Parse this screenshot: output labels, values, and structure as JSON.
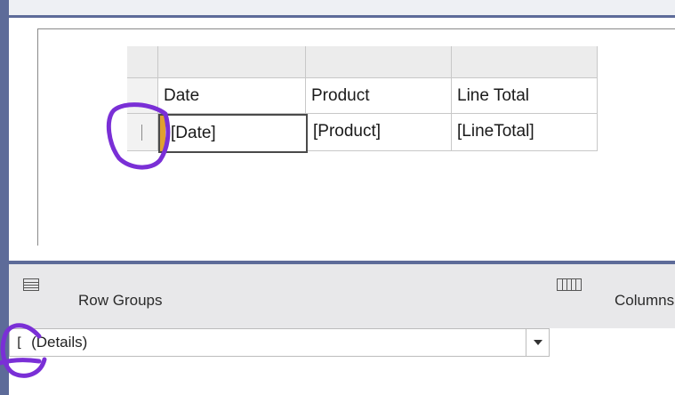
{
  "tablix": {
    "header_row": [
      "Date",
      "Product",
      "Line Total"
    ],
    "detail_row": [
      "[Date]",
      "[Product]",
      "[LineTotal]"
    ]
  },
  "grouping": {
    "row_groups_label": "Row Groups",
    "column_groups_label": "Columns",
    "row_group_items": [
      "(Details)"
    ]
  },
  "colors": {
    "frame": "#5d6b99",
    "annotation": "#7a2fd6",
    "marker": "#e0a030"
  },
  "icons": [
    "row-groups-icon",
    "column-groups-icon",
    "chevron-down-icon"
  ]
}
